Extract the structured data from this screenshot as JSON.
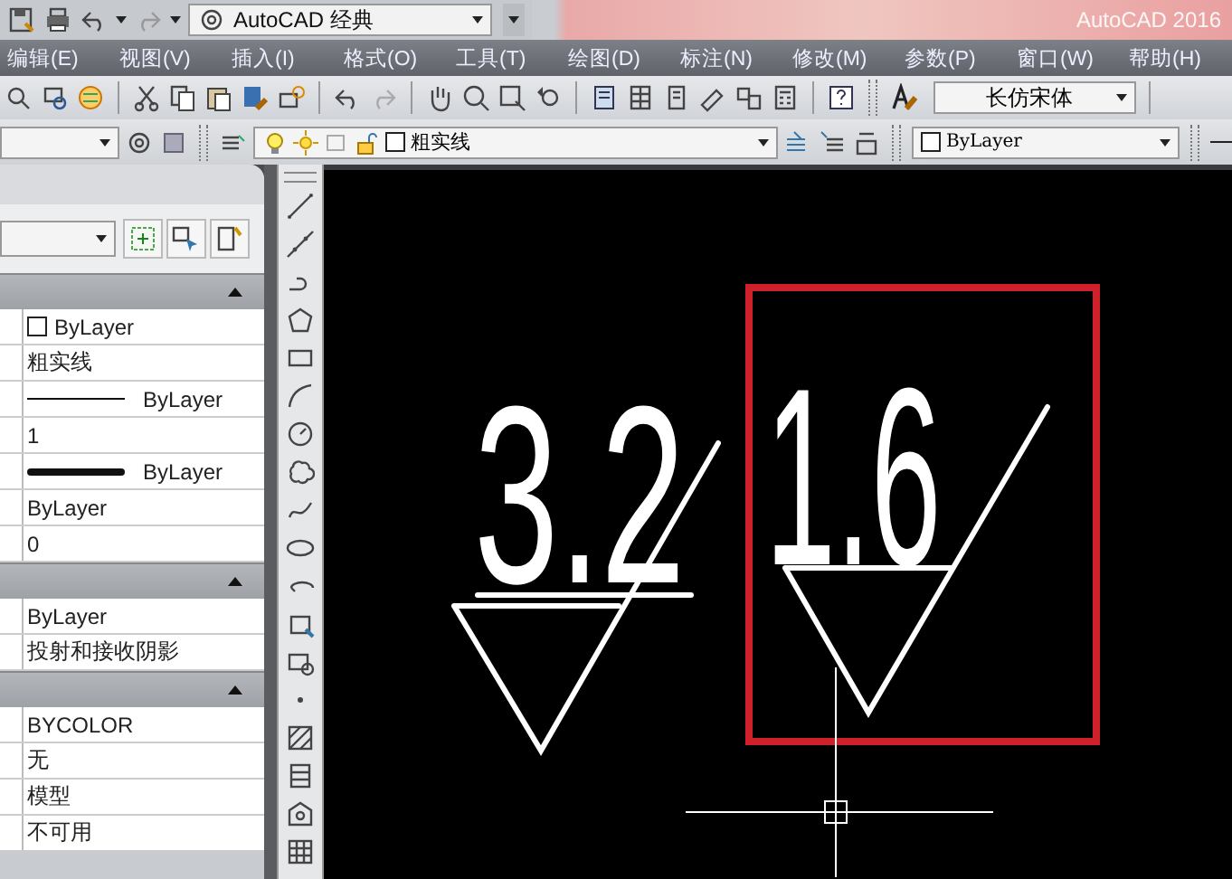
{
  "title_bar": {
    "workspace": "AutoCAD 经典",
    "title": "AutoCAD 2016"
  },
  "menu_bar": [
    "编辑(E)",
    "视图(V)",
    "插入(I)",
    "格式(O)",
    "工具(T)",
    "绘图(D)",
    "标注(N)",
    "修改(M)",
    "参数(P)",
    "窗口(W)",
    "帮助(H)"
  ],
  "text_style": {
    "font": "长仿宋体"
  },
  "layer_toolbar": {
    "layer": "粗实线",
    "color_setting": "ByLayer"
  },
  "properties": {
    "sections": [
      {
        "expanded": true,
        "rows": [
          {
            "kind": "color",
            "value": "ByLayer"
          },
          {
            "kind": "text",
            "value": "粗实线"
          },
          {
            "kind": "linetype",
            "value": "ByLayer"
          },
          {
            "kind": "text",
            "value": "1"
          },
          {
            "kind": "lineweight",
            "value": "ByLayer"
          },
          {
            "kind": "text",
            "value": "ByLayer"
          },
          {
            "kind": "text",
            "value": "0"
          }
        ]
      },
      {
        "expanded": true,
        "rows": [
          {
            "kind": "text",
            "value": "ByLayer"
          },
          {
            "kind": "text",
            "value": "投射和接收阴影"
          }
        ]
      },
      {
        "expanded": true,
        "rows": [
          {
            "kind": "text",
            "value": "BYCOLOR"
          },
          {
            "kind": "text",
            "value": "无"
          },
          {
            "kind": "text",
            "value": "模型"
          },
          {
            "kind": "text",
            "value": "不可用"
          }
        ]
      }
    ]
  },
  "drawing": {
    "symbols": [
      {
        "value": "3.2",
        "highlighted": false
      },
      {
        "value": "1.6",
        "highlighted": true
      }
    ]
  }
}
